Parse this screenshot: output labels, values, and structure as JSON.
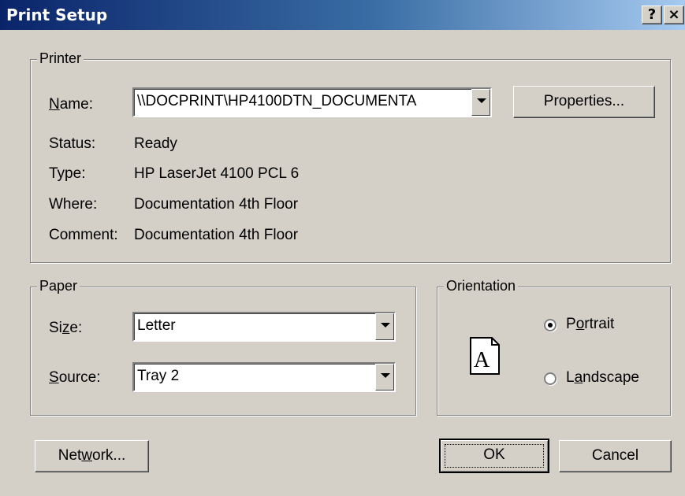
{
  "window": {
    "title": "Print Setup",
    "help_glyph": "?",
    "close_glyph": "×"
  },
  "printer": {
    "group_label": "Printer",
    "name_label": "Name:",
    "name_value": "\\\\DOCPRINT\\HP4100DTN_DOCUMENTA",
    "properties_label": "Properties...",
    "status_label": "Status:",
    "status_value": "Ready",
    "type_label": "Type:",
    "type_value": "HP LaserJet 4100 PCL 6",
    "where_label": "Where:",
    "where_value": "Documentation 4th Floor",
    "comment_label": "Comment:",
    "comment_value": "Documentation 4th Floor"
  },
  "paper": {
    "group_label": "Paper",
    "size_label": "Size:",
    "size_value": "Letter",
    "source_label": "Source:",
    "source_value": "Tray 2"
  },
  "orientation": {
    "group_label": "Orientation",
    "portrait_label": "Portrait",
    "landscape_label": "Landscape",
    "selected": "portrait",
    "page_icon_letter": "A"
  },
  "buttons": {
    "network_label": "Network...",
    "ok_label": "OK",
    "cancel_label": "Cancel"
  },
  "icons": {
    "dropdown": "chevron-down-icon",
    "page": "portrait-page-icon"
  }
}
